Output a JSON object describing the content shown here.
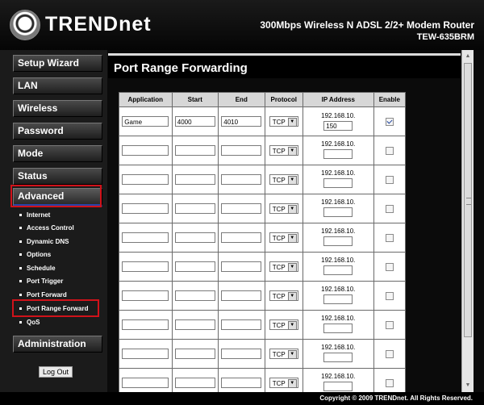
{
  "brand": {
    "logo_text": "TRENDnet",
    "product_title": "300Mbps Wireless N ADSL 2/2+ Modem Router",
    "model": "TEW-635BRM"
  },
  "sidebar": {
    "items": [
      {
        "label": "Setup Wizard"
      },
      {
        "label": "LAN"
      },
      {
        "label": "Wireless"
      },
      {
        "label": "Password"
      },
      {
        "label": "Mode"
      },
      {
        "label": "Status"
      },
      {
        "label": "Advanced"
      },
      {
        "label": "Administration"
      }
    ],
    "subitems": [
      {
        "label": "Internet"
      },
      {
        "label": "Access Control"
      },
      {
        "label": "Dynamic DNS"
      },
      {
        "label": "Options"
      },
      {
        "label": "Schedule"
      },
      {
        "label": "Port Trigger"
      },
      {
        "label": "Port Forward"
      },
      {
        "label": "Port Range Forward"
      },
      {
        "label": "QoS"
      }
    ],
    "logout_label": "Log Out"
  },
  "main": {
    "title": "Port Range Forwarding",
    "table": {
      "headers": [
        "Application",
        "Start",
        "End",
        "Protocol",
        "IP Address",
        "Enable"
      ],
      "ip_prefix": "192.168.10.",
      "rows": [
        {
          "app": "Game",
          "start": "4000",
          "end": "4010",
          "protocol": "TCP",
          "ip": "150",
          "enabled": true
        },
        {
          "app": "",
          "start": "",
          "end": "",
          "protocol": "TCP",
          "ip": "",
          "enabled": false
        },
        {
          "app": "",
          "start": "",
          "end": "",
          "protocol": "TCP",
          "ip": "",
          "enabled": false
        },
        {
          "app": "",
          "start": "",
          "end": "",
          "protocol": "TCP",
          "ip": "",
          "enabled": false
        },
        {
          "app": "",
          "start": "",
          "end": "",
          "protocol": "TCP",
          "ip": "",
          "enabled": false
        },
        {
          "app": "",
          "start": "",
          "end": "",
          "protocol": "TCP",
          "ip": "",
          "enabled": false
        },
        {
          "app": "",
          "start": "",
          "end": "",
          "protocol": "TCP",
          "ip": "",
          "enabled": false
        },
        {
          "app": "",
          "start": "",
          "end": "",
          "protocol": "TCP",
          "ip": "",
          "enabled": false
        },
        {
          "app": "",
          "start": "",
          "end": "",
          "protocol": "TCP",
          "ip": "",
          "enabled": false
        },
        {
          "app": "",
          "start": "",
          "end": "",
          "protocol": "TCP",
          "ip": "",
          "enabled": false
        }
      ]
    }
  },
  "footer": {
    "copyright": "Copyright © 2009 TRENDnet. All Rights Reserved."
  },
  "colors": {
    "highlight_outline": "#d0121a",
    "active_underline": "#2b43a8"
  }
}
